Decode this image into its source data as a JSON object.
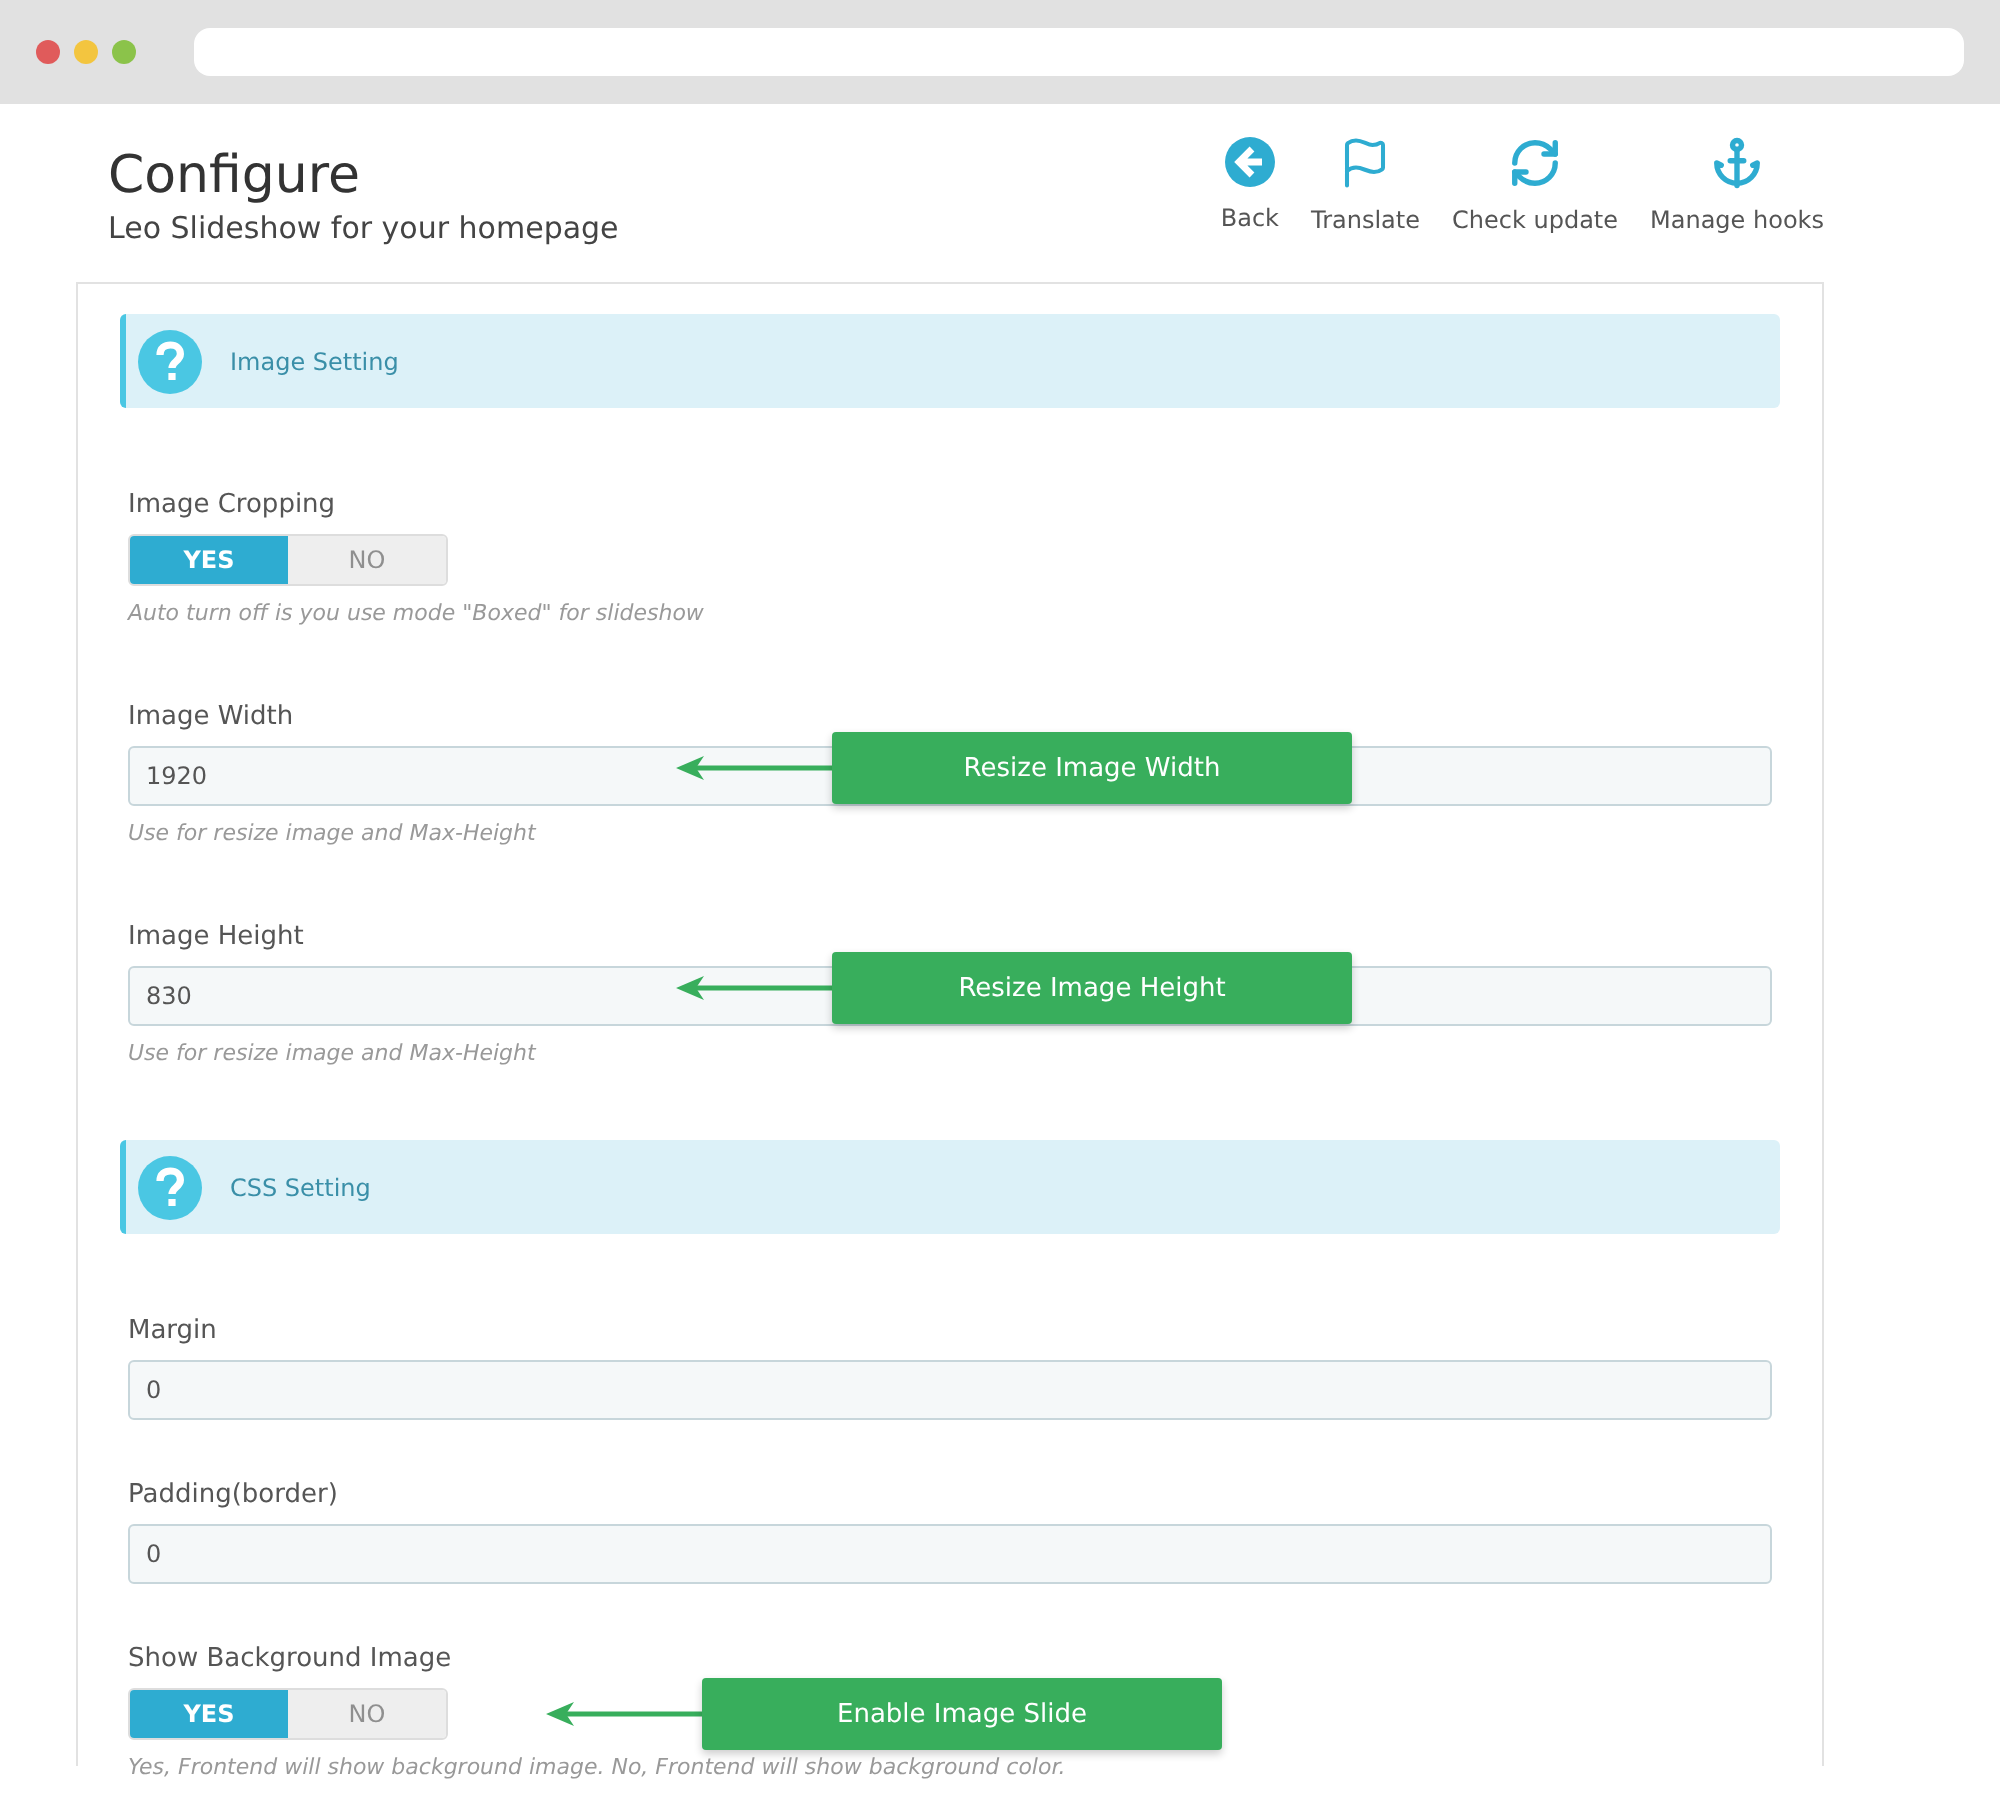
{
  "header": {
    "title": "Configure",
    "subtitle": "Leo Slideshow for your homepage"
  },
  "toolbar": [
    {
      "kind": "back",
      "label": "Back"
    },
    {
      "kind": "flag",
      "label": "Translate"
    },
    {
      "kind": "refresh",
      "label": "Check update"
    },
    {
      "kind": "anchor",
      "label": "Manage hooks"
    }
  ],
  "sections": [
    {
      "title": "Image Setting",
      "fields": [
        {
          "kind": "switch",
          "label": "Image Cropping",
          "options": [
            {
              "label": "YES",
              "selected": true
            },
            {
              "label": "NO",
              "selected": false
            }
          ],
          "help": "Auto turn off is you use mode \"Boxed\" for slideshow"
        },
        {
          "kind": "text",
          "label": "Image Width",
          "value": "1920",
          "help": "Use for resize image and Max-Height",
          "callout": "Resize Image Width"
        },
        {
          "kind": "text",
          "label": "Image Height",
          "value": "830",
          "help": "Use for resize image and Max-Height",
          "callout": "Resize Image Height"
        }
      ]
    },
    {
      "title": "CSS Setting",
      "fields": [
        {
          "kind": "text",
          "label": "Margin",
          "value": "0"
        },
        {
          "kind": "text",
          "label": "Padding(border)",
          "value": "0"
        },
        {
          "kind": "switch",
          "label": "Show Background Image",
          "options": [
            {
              "label": "YES",
              "selected": true
            },
            {
              "label": "NO",
              "selected": false
            }
          ],
          "help": "Yes, Frontend will show background image. No, Frontend will show background color.",
          "callout": "Enable Image Slide"
        }
      ]
    }
  ]
}
